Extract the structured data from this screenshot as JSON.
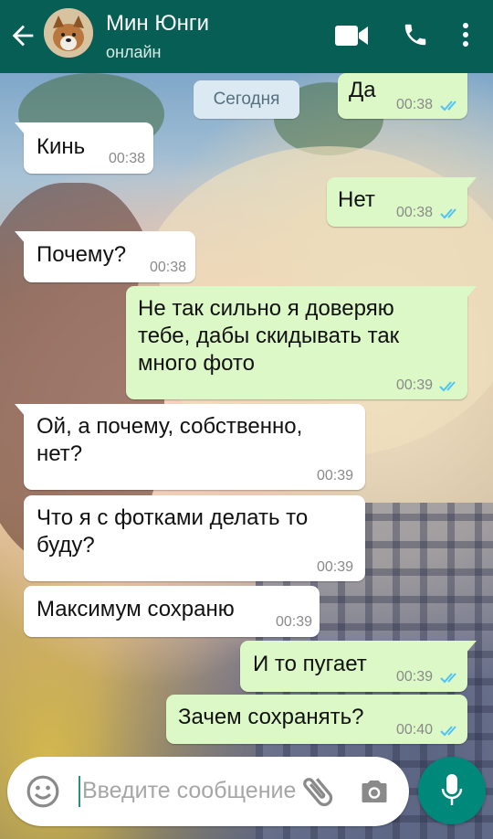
{
  "header": {
    "contact_name": "Мин Юнги",
    "status": "онлайн"
  },
  "date_chip": "Сегодня",
  "messages": [
    {
      "direction": "out",
      "text": "Да",
      "time": "00:38",
      "ticks": "double-check-blue"
    },
    {
      "direction": "in",
      "text": "Кинь",
      "time": "00:38"
    },
    {
      "direction": "out",
      "text": "Нет",
      "time": "00:38",
      "ticks": "double-check-blue"
    },
    {
      "direction": "in",
      "text": "Почему?",
      "time": "00:38"
    },
    {
      "direction": "out",
      "lines": [
        "Не так сильно я доверяю",
        "тебе, дабы скидывать так",
        "много фото"
      ],
      "time": "00:39",
      "ticks": "double-check-blue"
    },
    {
      "direction": "in",
      "lines": [
        "Ой, а почему, собственно,",
        "нет?"
      ],
      "time": "00:39"
    },
    {
      "direction": "in",
      "lines": [
        "Что я с фотками делать то",
        "буду?"
      ],
      "time": "00:39"
    },
    {
      "direction": "in",
      "text": "Максимум сохраню",
      "time": "00:39"
    },
    {
      "direction": "out",
      "text": "И то пугает",
      "time": "00:39",
      "ticks": "double-check-blue"
    },
    {
      "direction": "out",
      "text": "Зачем сохранять?",
      "time": "00:40",
      "ticks": "double-check-blue"
    }
  ],
  "input": {
    "placeholder": "Введите сообщение"
  },
  "colors": {
    "header": "#075e54",
    "outgoing_bubble": "#dcf8c6",
    "incoming_bubble": "#ffffff",
    "read_ticks": "#4fc3f7",
    "mic_button": "#00897b"
  },
  "icons": [
    "back-arrow-icon",
    "video-call-icon",
    "phone-icon",
    "more-vert-icon",
    "emoji-icon",
    "attach-icon",
    "camera-icon",
    "mic-icon",
    "double-check-icon"
  ]
}
